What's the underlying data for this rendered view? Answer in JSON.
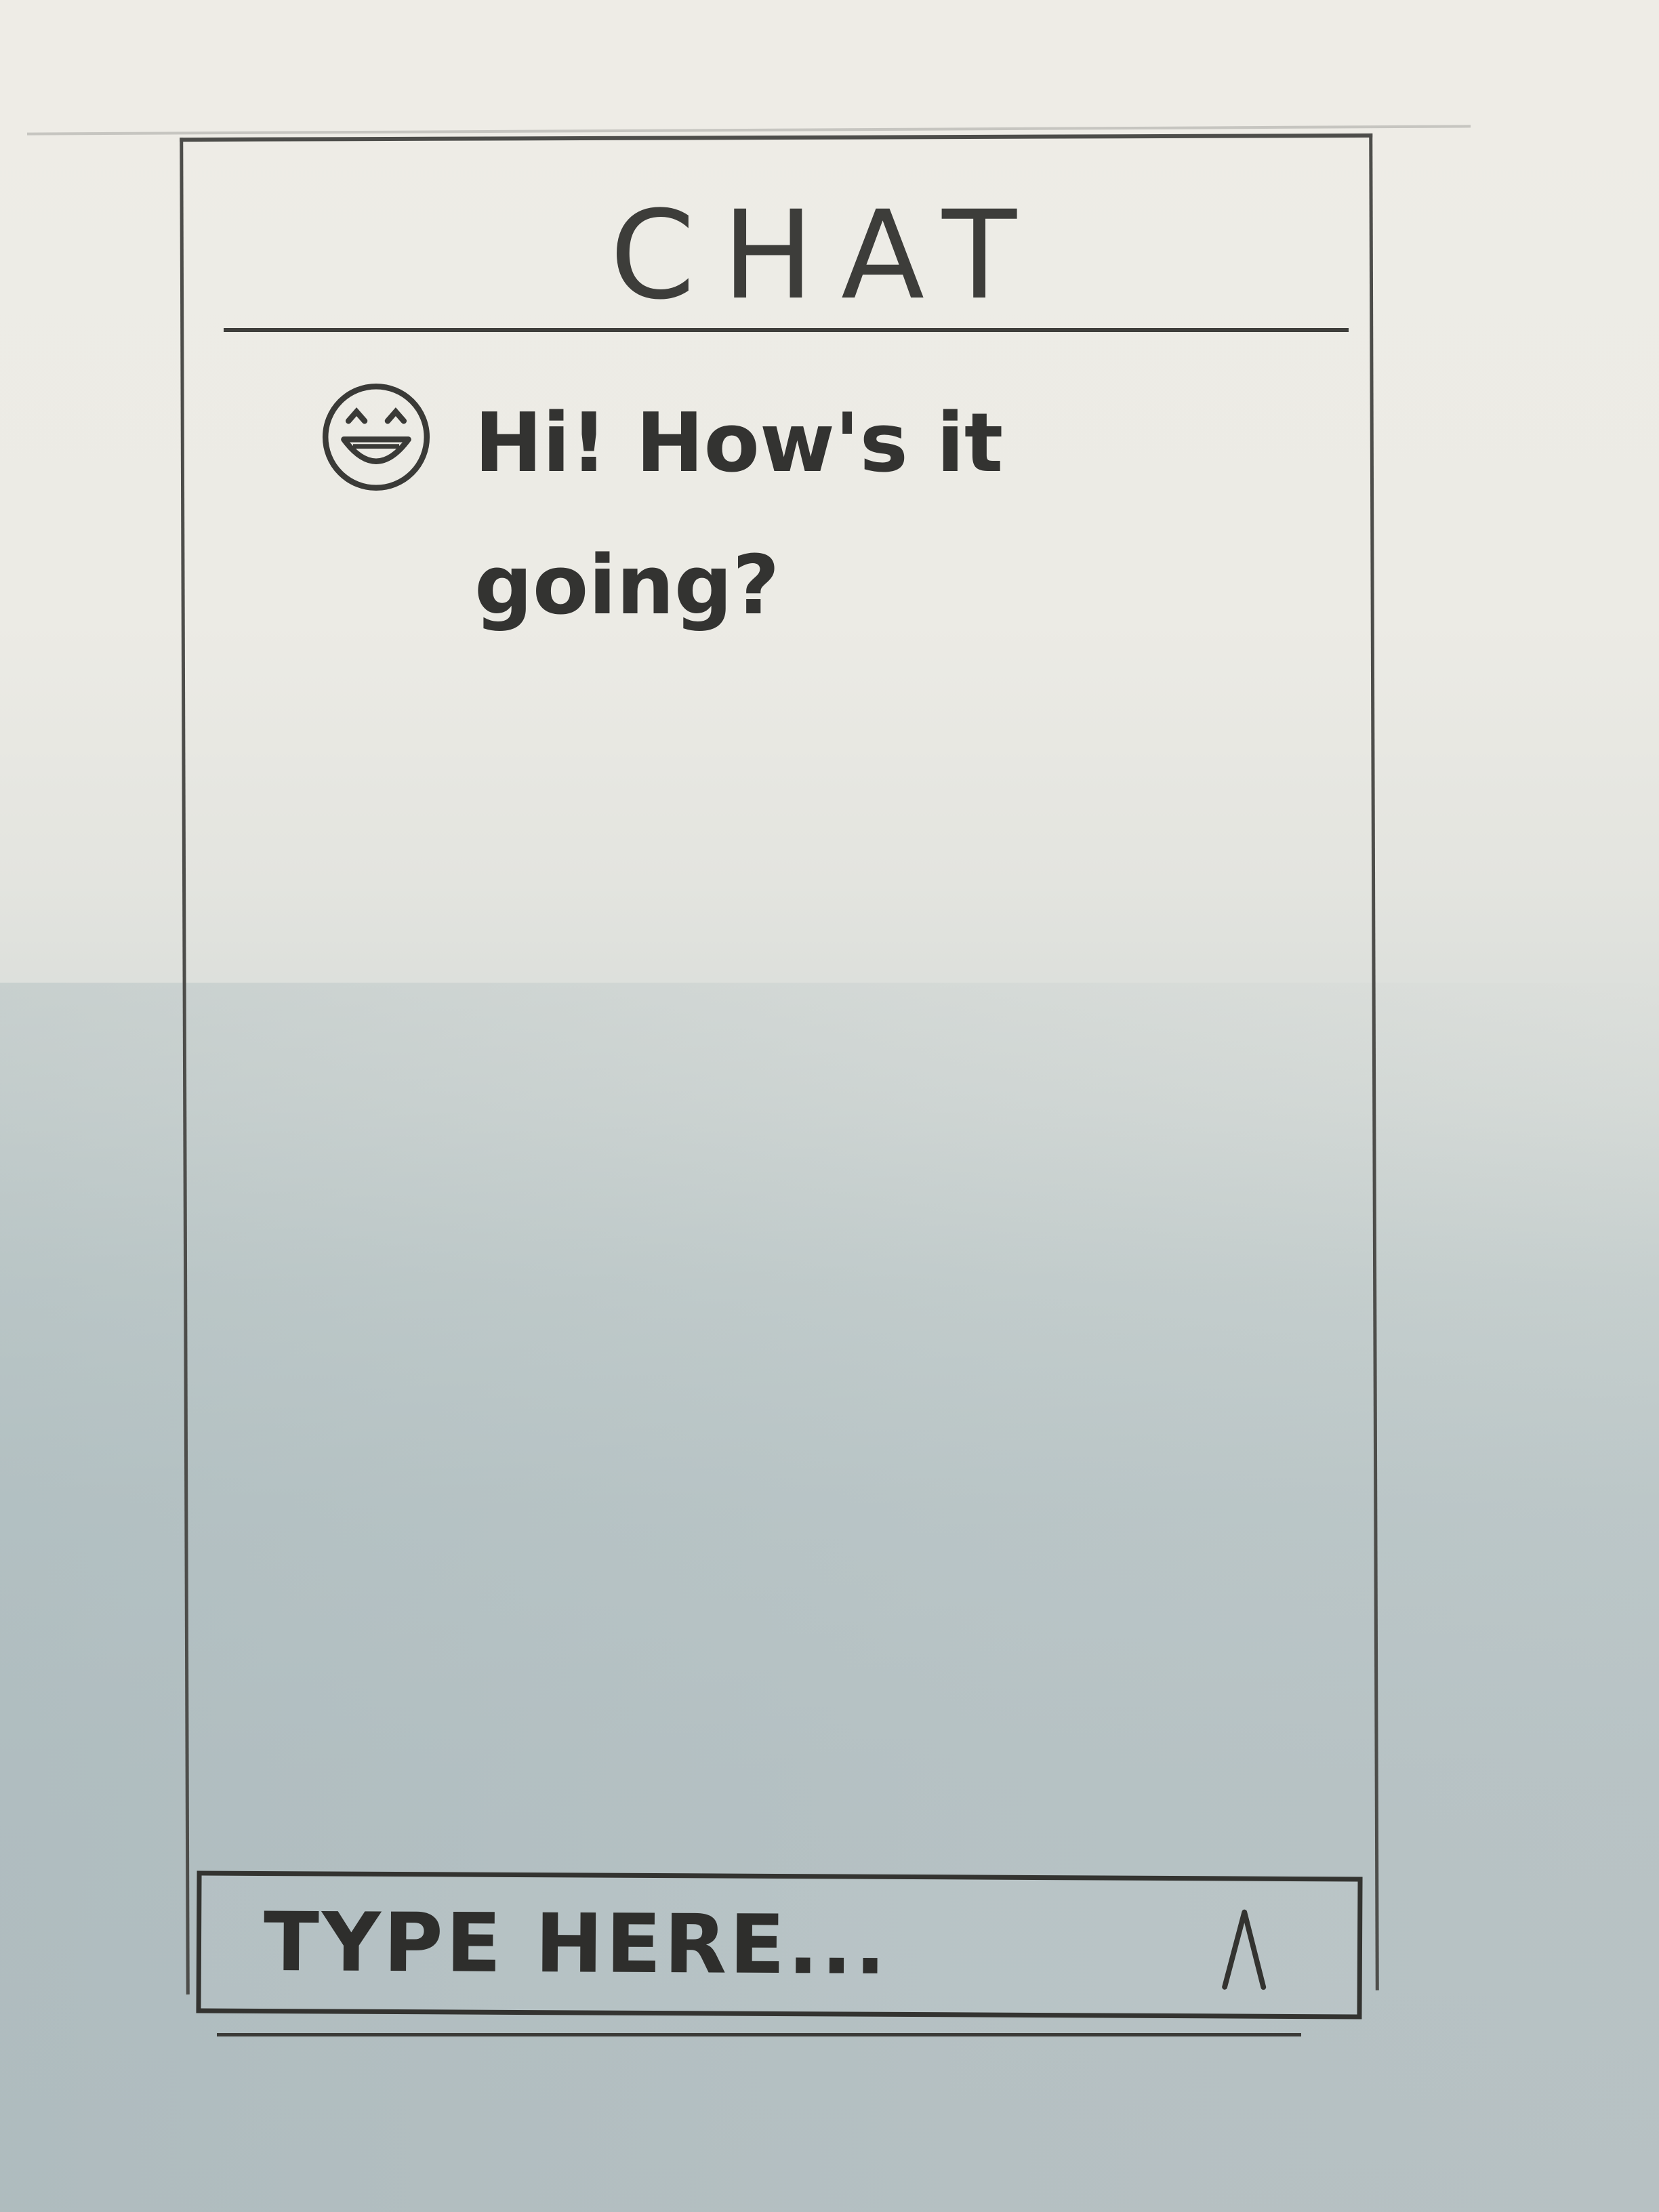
{
  "header": {
    "title": "CHAT"
  },
  "messages": [
    {
      "avatar_icon": "smiley-face-icon",
      "text": "Hi! How's it going?"
    }
  ],
  "composer": {
    "placeholder": "TYPE HERE...",
    "value": "",
    "send_icon": "send-arrow-icon"
  },
  "colors": {
    "ink": "#3a3a38",
    "paper": "#ecebe5",
    "shadow": "#b8c3c5"
  }
}
